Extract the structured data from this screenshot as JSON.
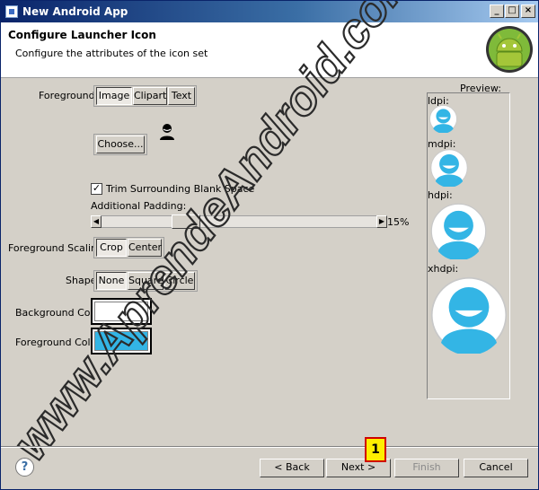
{
  "window": {
    "title": "New Android App"
  },
  "header": {
    "title": "Configure Launcher Icon",
    "subtitle": "Configure the attributes of the icon set"
  },
  "foreground": {
    "label": "Foreground:",
    "options": [
      "Image",
      "Clipart",
      "Text"
    ],
    "selected": "Image",
    "choose_label": "Choose..."
  },
  "trim": {
    "label": "Trim Surrounding Blank Space",
    "checked": true
  },
  "padding": {
    "label": "Additional Padding:",
    "value": "15%"
  },
  "scaling": {
    "label": "Foreground Scaling:",
    "options": [
      "Crop",
      "Center"
    ],
    "selected": "Crop"
  },
  "shape": {
    "label": "Shape",
    "options": [
      "None",
      "Square",
      "Circle"
    ],
    "selected": "None"
  },
  "background_color": {
    "label": "Background Color:",
    "value": "#ffffff"
  },
  "foreground_color": {
    "label": "Foreground Color:",
    "value": "#33b5e5"
  },
  "preview": {
    "title": "Preview:",
    "densities": [
      "ldpi:",
      "mdpi:",
      "hdpi:",
      "xhdpi:"
    ]
  },
  "footer": {
    "help": "?",
    "back": "< Back",
    "next": "Next >",
    "finish": "Finish",
    "cancel": "Cancel"
  },
  "annotation": {
    "number": "1"
  },
  "watermark": {
    "text": "www.AprendeAndroid.com"
  },
  "colors": {
    "accent": "#33b5e5",
    "title_bar": "#0a246a",
    "face": "#d4d0c8"
  }
}
